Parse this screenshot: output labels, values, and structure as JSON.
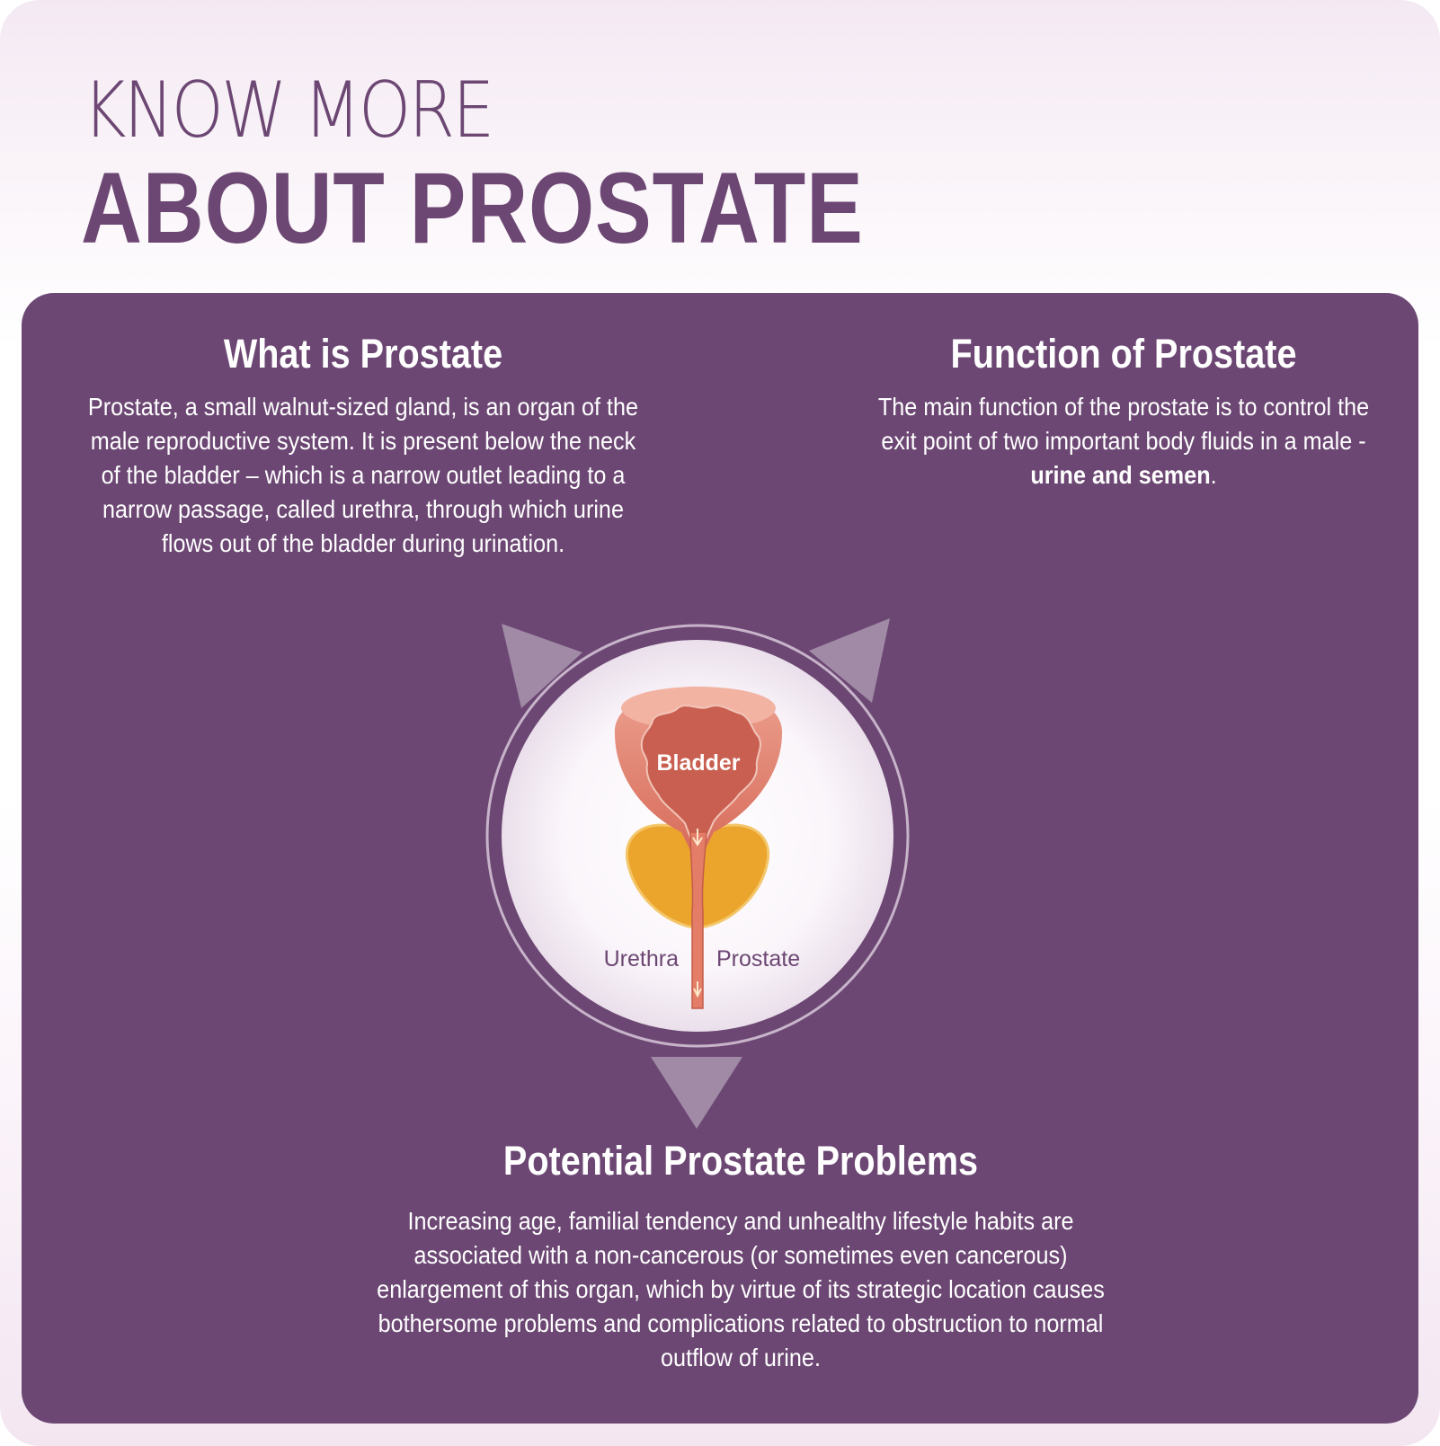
{
  "header": {
    "title_light": "KNOW MORE",
    "title_bold": "ABOUT PROSTATE"
  },
  "what_is": {
    "heading": "What is Prostate",
    "body": "Prostate, a small walnut-sized gland, is an organ of the male reproductive system. It is present below the neck of the bladder – which is a narrow outlet leading to a narrow passage, called urethra, through which urine flows out of the bladder during urination."
  },
  "function": {
    "heading": "Function of Prostate",
    "body_prefix": "The main function of the prostate is to control the exit point of two important body fluids in a male - ",
    "body_bold": "urine and semen",
    "body_suffix": "."
  },
  "diagram": {
    "bladder_label": "Bladder",
    "urethra_label": "Urethra",
    "prostate_label": "Prostate"
  },
  "problems": {
    "heading": "Potential Prostate Problems",
    "body": "Increasing age, familial tendency and unhealthy lifestyle habits are associated with a non-cancerous (or sometimes even cancerous) enlargement of this organ, which by virtue of its strategic location causes bothersome problems and complications related to obstruction to normal outflow of urine."
  },
  "colors": {
    "brand_purple": "#6c4773",
    "bladder_red": "#d9705f",
    "prostate_orange": "#eba42c",
    "arrow_mauve": "#a08aa6"
  }
}
